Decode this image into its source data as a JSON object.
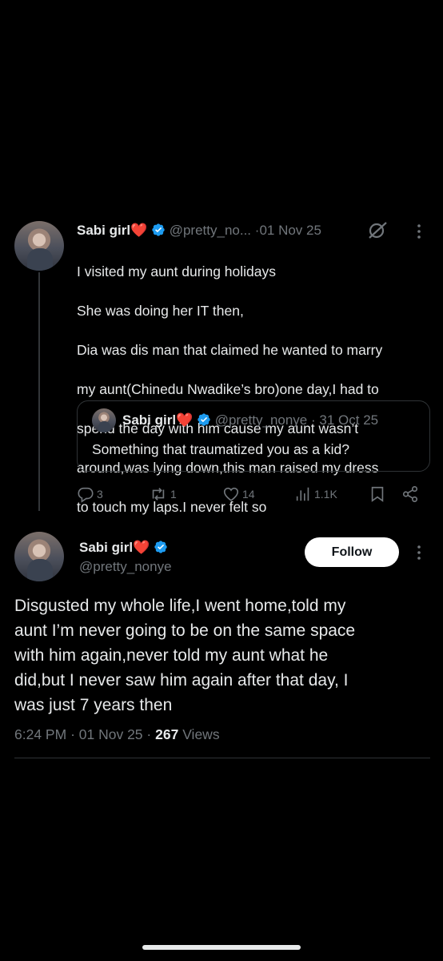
{
  "parent_tweet": {
    "display_name": "Sabi girl",
    "handle": "@pretty_no...",
    "separator": "·",
    "date": "01 Nov 25",
    "text_lines": [
      "I visited my aunt during holidays",
      "She was doing her IT then,",
      "Dia was dis man that claimed he wanted to marry",
      "my aunt(Chinedu Nwadike’s bro)one day,I had to",
      "spend the day with him cause my aunt wasn’t",
      "around,was lying down,this man raised my dress",
      "to touch my laps.I never felt so"
    ],
    "quote": {
      "display_name": "Sabi girl",
      "handle": "@pretty_nonye",
      "separator": "·",
      "date": "31 Oct 25",
      "text": "Something that traumatized you as a kid?"
    },
    "actions": {
      "replies": "3",
      "reposts": "1",
      "likes": "14",
      "views": "1.1K"
    }
  },
  "main_tweet": {
    "display_name": "Sabi girl",
    "handle": "@pretty_nonye",
    "follow_label": "Follow",
    "text_lines": [
      "Disgusted my whole life,I went home,told my",
      "aunt I’m never going to be on the same space",
      "with him again,never told my aunt what he",
      "did,but I never saw him again after that day, I",
      "was just 7 years then"
    ],
    "time": "6:24 PM",
    "date": "01 Nov 25",
    "separator": "·",
    "views_count": "267",
    "views_label": "Views"
  },
  "colors": {
    "background": "#000000",
    "text": "#e7e9ea",
    "muted": "#71767b",
    "verified": "#1d9bf0",
    "heart": "#e0245e"
  },
  "icons": {
    "verified": "verified-badge-icon",
    "grok": "grok-icon",
    "more": "more-dots-icon",
    "reply": "reply-icon",
    "repost": "repost-icon",
    "like": "heart-icon",
    "views": "views-icon",
    "bookmark": "bookmark-icon",
    "share": "share-icon"
  }
}
